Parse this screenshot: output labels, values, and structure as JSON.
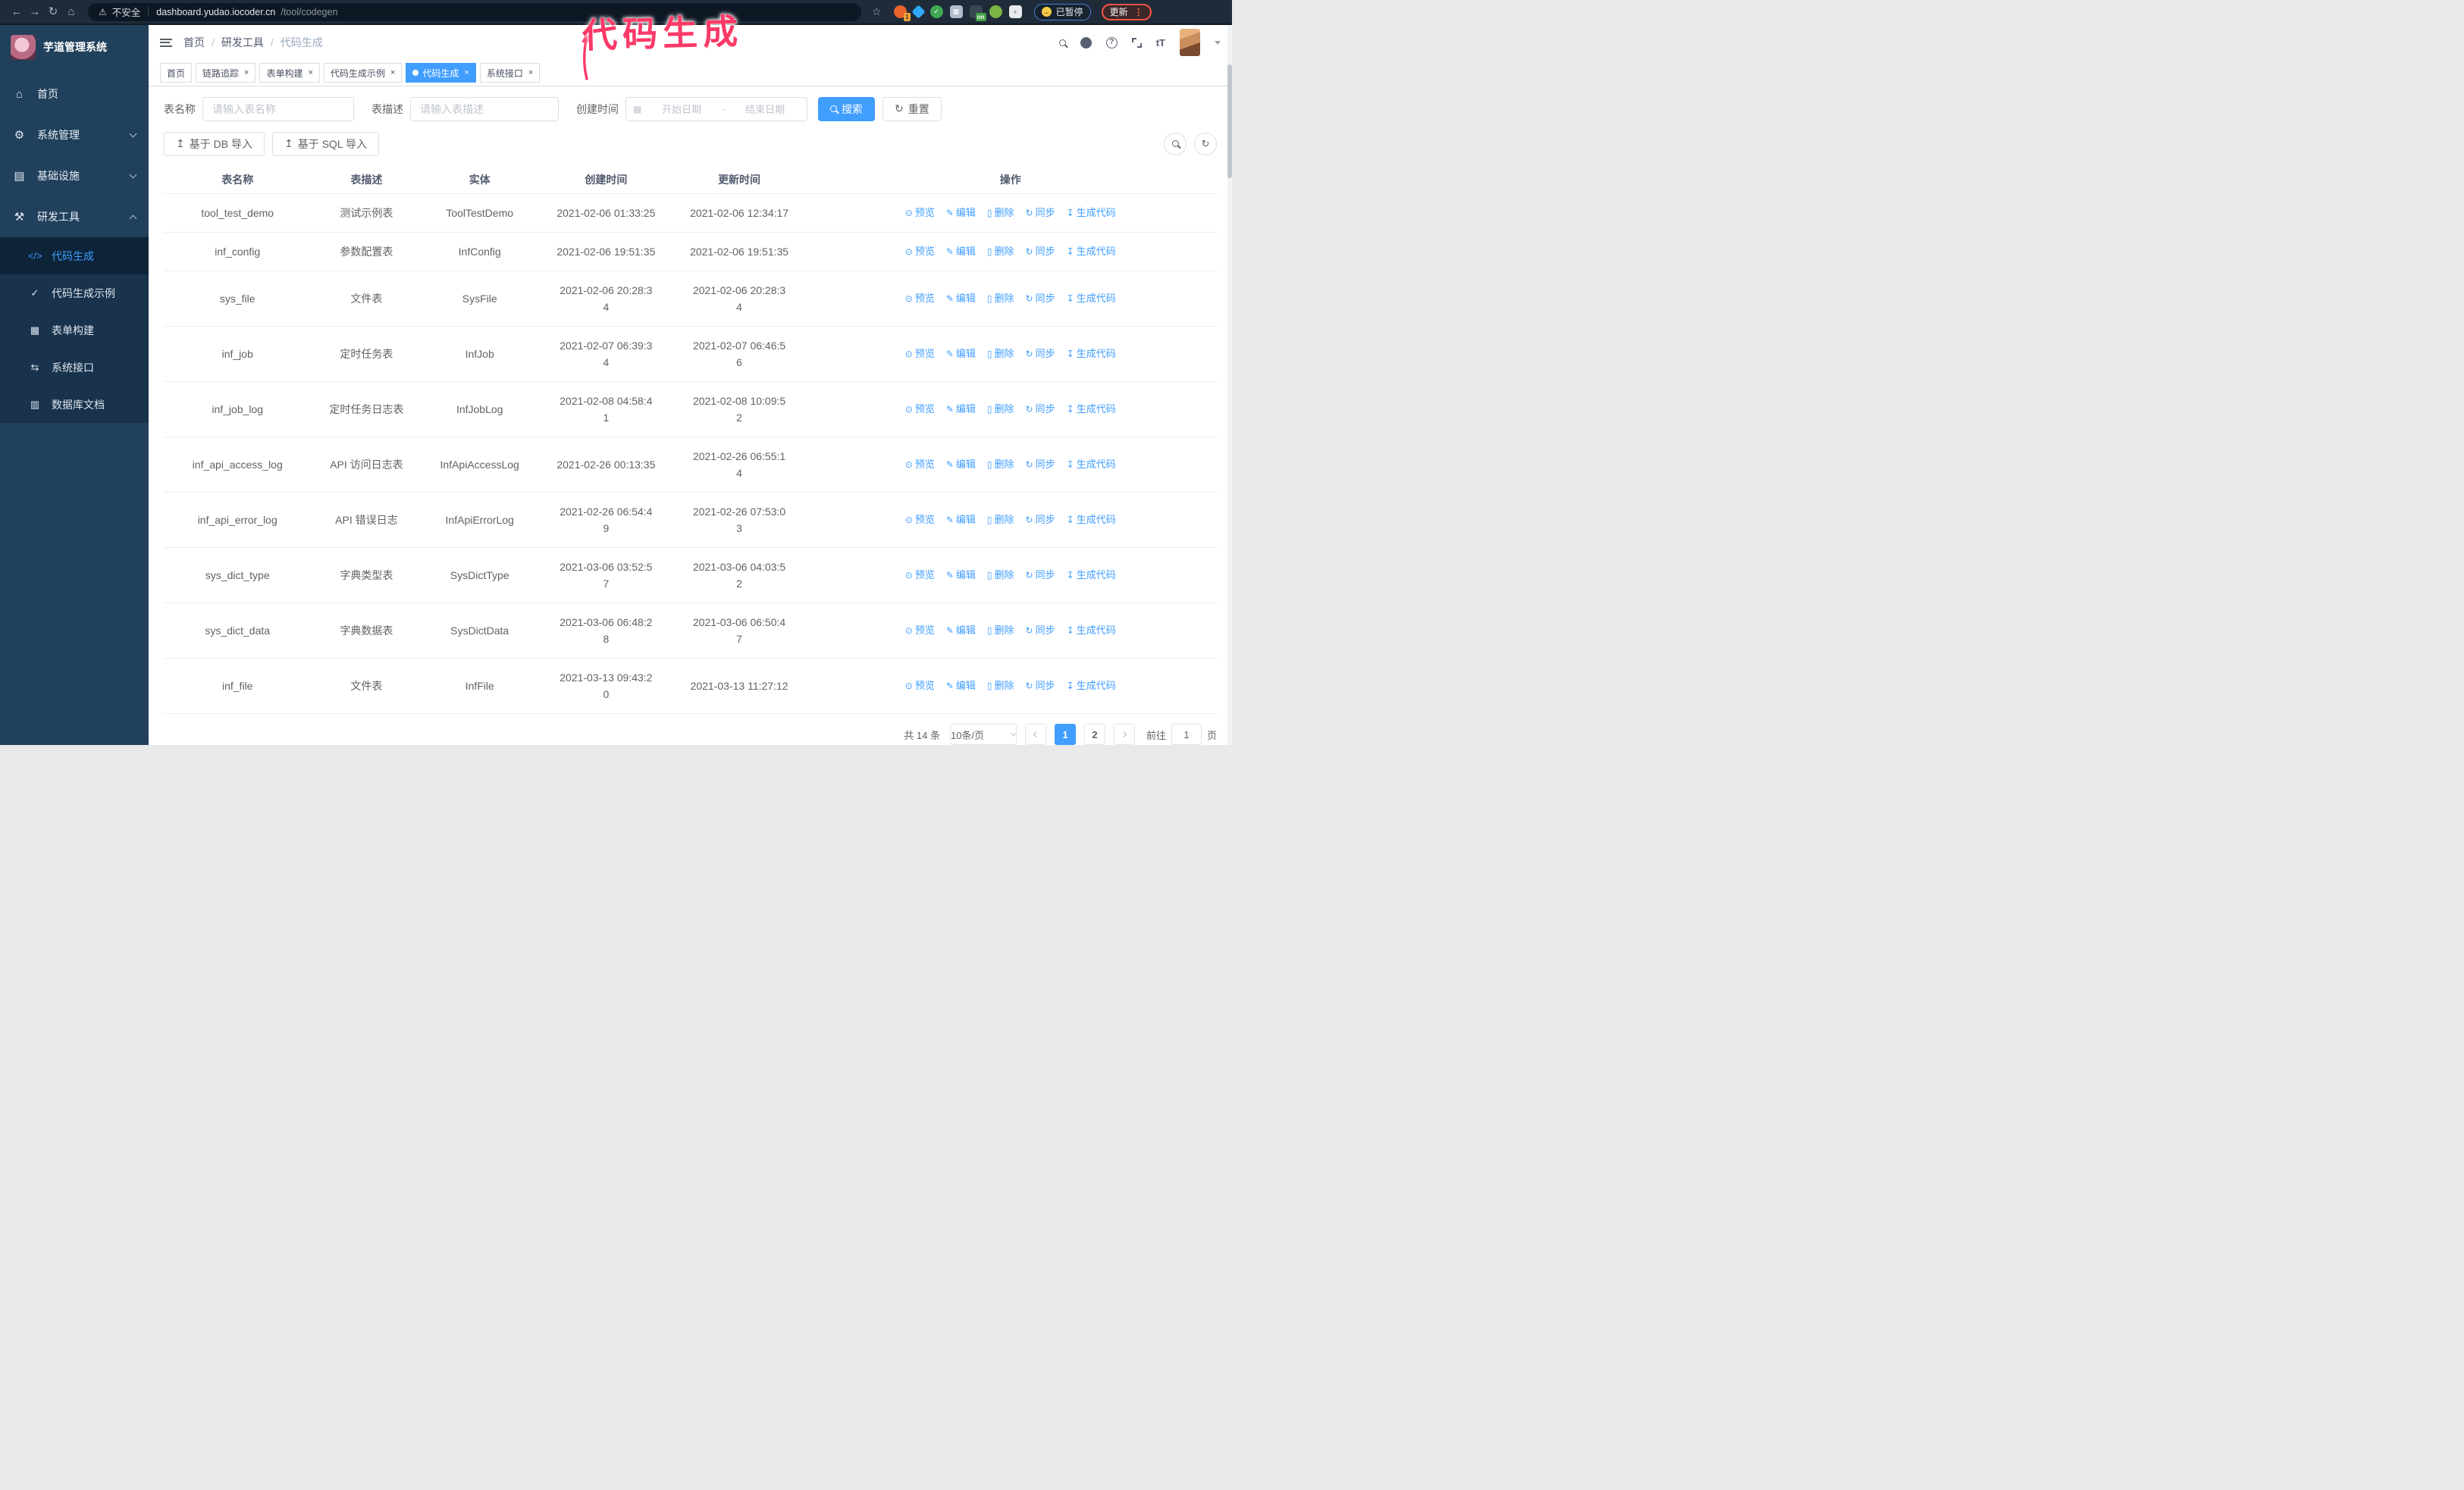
{
  "annotation": {
    "text": "代码生成",
    "color": "#fb3a68"
  },
  "browser": {
    "nav_icons": [
      {
        "name": "back-arrow-icon",
        "glyph": "back"
      },
      {
        "name": "forward-arrow-icon",
        "glyph": "forward"
      },
      {
        "name": "reload-icon",
        "glyph": "reload"
      },
      {
        "name": "home-icon",
        "glyph": "home"
      }
    ],
    "security_label": "不安全",
    "url_host": "dashboard.yudao.iocoder.cn",
    "url_path": "/tool/codegen",
    "extensions": [
      {
        "name": "orange-extension-icon",
        "color": "#e8622c",
        "shape": "circle",
        "badge": "1"
      },
      {
        "name": "blue-gem-extension-icon",
        "color": "#2fa8f8",
        "shape": "diamond",
        "glyph": ""
      },
      {
        "name": "green-check-extension-icon",
        "color": "#3faa53",
        "shape": "circle",
        "glyph": "✓"
      },
      {
        "name": "grid-extension-icon",
        "color": "#aebdc9",
        "shape": "square",
        "glyph": "▦"
      },
      {
        "name": "onetab-extension-icon",
        "color": "#37474f",
        "shape": "square",
        "badge": "on",
        "badge_color": "#43a047"
      },
      {
        "name": "green-bot-extension-icon",
        "color": "#7cb342",
        "shape": "circle",
        "glyph": ""
      },
      {
        "name": "puzzle-extension-icon",
        "color": "#e7ebee",
        "shape": "square",
        "glyph": "+",
        "glyph_color": "#5f6b76"
      }
    ],
    "paused_label": "已暂停",
    "update_label": "更新"
  },
  "sidebar": {
    "title": "芋道管理系统",
    "items": [
      {
        "label": "首页",
        "icon": "home",
        "chevron": ""
      },
      {
        "label": "系统管理",
        "icon": "gear",
        "chevron": "down"
      },
      {
        "label": "基础设施",
        "icon": "monitor",
        "chevron": "down"
      },
      {
        "label": "研发工具",
        "icon": "toolbox",
        "chevron": "up"
      }
    ],
    "submenu": [
      {
        "label": "代码生成",
        "icon": "code",
        "active": true
      },
      {
        "label": "代码生成示例",
        "icon": "example-check",
        "active": false
      },
      {
        "label": "表单构建",
        "icon": "form",
        "active": false
      },
      {
        "label": "系统接口",
        "icon": "api",
        "active": false
      },
      {
        "label": "数据库文档",
        "icon": "database",
        "active": false
      }
    ]
  },
  "header": {
    "breadcrumb": [
      "首页",
      "研发工具",
      "代码生成"
    ]
  },
  "tabs": [
    {
      "label": "首页",
      "closable": false,
      "active": false
    },
    {
      "label": "链路追踪",
      "closable": true,
      "active": false
    },
    {
      "label": "表单构建",
      "closable": true,
      "active": false
    },
    {
      "label": "代码生成示例",
      "closable": true,
      "active": false
    },
    {
      "label": "代码生成",
      "closable": true,
      "active": true
    },
    {
      "label": "系统接口",
      "closable": true,
      "active": false
    }
  ],
  "filters": {
    "name_label": "表名称",
    "name_placeholder": "请输入表名称",
    "desc_label": "表描述",
    "desc_placeholder": "请输入表描述",
    "time_label": "创建时间",
    "start_placeholder": "开始日期",
    "range_separator": "-",
    "end_placeholder": "结束日期",
    "search_label": "搜索",
    "reset_label": "重置"
  },
  "toolbar": {
    "import_db_label": "基于 DB 导入",
    "import_sql_label": "基于 SQL 导入"
  },
  "table": {
    "columns": [
      "表名称",
      "表描述",
      "实体",
      "创建时间",
      "更新时间",
      "操作"
    ],
    "actions": [
      {
        "label": "预览",
        "icon": "eye"
      },
      {
        "label": "编辑",
        "icon": "edit"
      },
      {
        "label": "删除",
        "icon": "trash"
      },
      {
        "label": "同步",
        "icon": "sync"
      },
      {
        "label": "生成代码",
        "icon": "download"
      }
    ],
    "rows": [
      {
        "name": "tool_test_demo",
        "desc": "测试示例表",
        "entity": "ToolTestDemo",
        "created": [
          "2021-02-06 01:33:25"
        ],
        "updated": [
          "2021-02-06 12:34:17"
        ]
      },
      {
        "name": "inf_config",
        "desc": "参数配置表",
        "entity": "InfConfig",
        "created": [
          "2021-02-06 19:51:35"
        ],
        "updated": [
          "2021-02-06 19:51:35"
        ]
      },
      {
        "name": "sys_file",
        "desc": "文件表",
        "entity": "SysFile",
        "created": [
          "2021-02-06 20:28:3",
          "4"
        ],
        "updated": [
          "2021-02-06 20:28:3",
          "4"
        ]
      },
      {
        "name": "inf_job",
        "desc": "定时任务表",
        "entity": "InfJob",
        "created": [
          "2021-02-07 06:39:3",
          "4"
        ],
        "updated": [
          "2021-02-07 06:46:5",
          "6"
        ]
      },
      {
        "name": "inf_job_log",
        "desc": "定时任务日志表",
        "entity": "InfJobLog",
        "created": [
          "2021-02-08 04:58:4",
          "1"
        ],
        "updated": [
          "2021-02-08 10:09:5",
          "2"
        ]
      },
      {
        "name": "inf_api_access_log",
        "desc": "API 访问日志表",
        "entity": "InfApiAccessLog",
        "created": [
          "2021-02-26 00:13:35"
        ],
        "updated": [
          "2021-02-26 06:55:1",
          "4"
        ]
      },
      {
        "name": "inf_api_error_log",
        "desc": "API 错误日志",
        "entity": "InfApiErrorLog",
        "created": [
          "2021-02-26 06:54:4",
          "9"
        ],
        "updated": [
          "2021-02-26 07:53:0",
          "3"
        ]
      },
      {
        "name": "sys_dict_type",
        "desc": "字典类型表",
        "entity": "SysDictType",
        "created": [
          "2021-03-06 03:52:5",
          "7"
        ],
        "updated": [
          "2021-03-06 04:03:5",
          "2"
        ]
      },
      {
        "name": "sys_dict_data",
        "desc": "字典数据表",
        "entity": "SysDictData",
        "created": [
          "2021-03-06 06:48:2",
          "8"
        ],
        "updated": [
          "2021-03-06 06:50:4",
          "7"
        ]
      },
      {
        "name": "inf_file",
        "desc": "文件表",
        "entity": "InfFile",
        "created": [
          "2021-03-13 09:43:2",
          "0"
        ],
        "updated": [
          "2021-03-13 11:27:12"
        ]
      }
    ]
  },
  "pagination": {
    "total_text": "共 14 条",
    "page_size": "10条/页",
    "pages": [
      "1",
      "2"
    ],
    "active_page": "1",
    "goto_label": "前往",
    "goto_value": "1",
    "goto_suffix": "页"
  },
  "colors": {
    "primary": "#409eff",
    "sidebar_bg": "#21405c",
    "submenu_bg": "#19334d",
    "submenu_active_bg": "#0d2338",
    "annotation_pink": "#fb3a68"
  }
}
